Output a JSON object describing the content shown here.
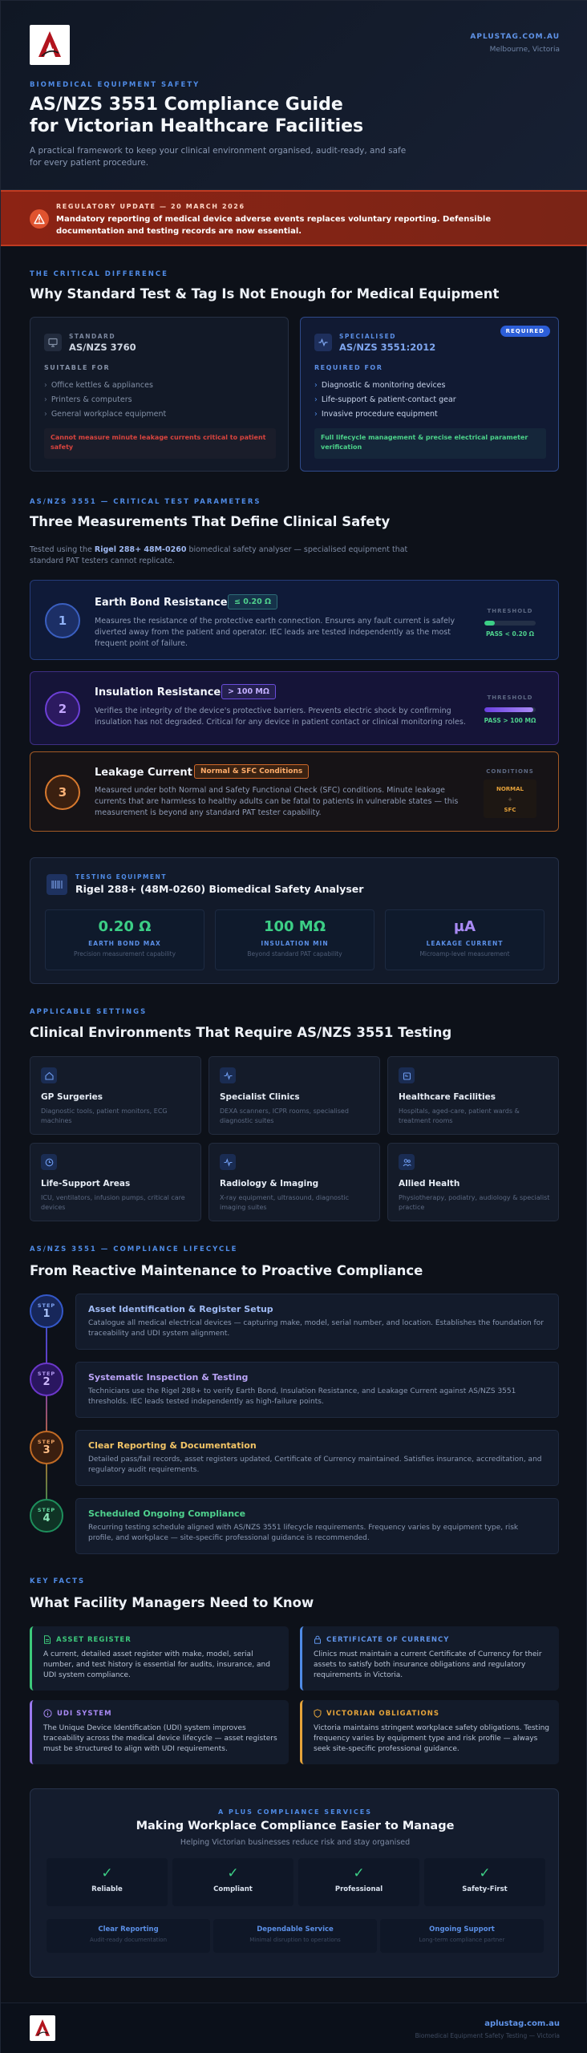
{
  "header": {
    "url": "APLUSTAG.COM.AU",
    "location": "Melbourne, Victoria",
    "eyebrow": "BIOMEDICAL EQUIPMENT SAFETY",
    "title_line1": "AS/NZS 3551 Compliance Guide",
    "title_line2": "for Victorian Healthcare Facilities",
    "subtitle": "A practical framework to keep your clinical environment organised, audit-ready, and safe for every patient procedure."
  },
  "alert": {
    "eyebrow": "REGULATORY UPDATE — 20 MARCH 2026",
    "text": "Mandatory reporting of medical device adverse events replaces voluntary reporting. Defensible documentation and testing records are now essential."
  },
  "difference": {
    "eyebrow": "THE CRITICAL DIFFERENCE",
    "title": "Why Standard Test & Tag Is Not Enough for Medical Equipment",
    "standard": {
      "small": "STANDARD",
      "name": "AS/NZS 3760",
      "suitable": "SUITABLE FOR",
      "items": [
        "Office kettles & appliances",
        "Printers & computers",
        "General workplace equipment"
      ],
      "note": "Cannot measure minute leakage currents critical to patient safety"
    },
    "specialised": {
      "badge": "REQUIRED",
      "small": "SPECIALISED",
      "name": "AS/NZS 3551:2012",
      "required": "REQUIRED FOR",
      "items": [
        "Diagnostic & monitoring devices",
        "Life-support & patient-contact gear",
        "Invasive procedure equipment"
      ],
      "note": "Full lifecycle management & precise electrical parameter verification"
    }
  },
  "measurements": {
    "eyebrow": "AS/NZS 3551 — CRITICAL TEST PARAMETERS",
    "title": "Three Measurements That Define Clinical Safety",
    "intro_pre": "Tested using the ",
    "intro_bold": "Rigel 288+ 48M-0260",
    "intro_post": " biomedical safety analyser — specialised equipment that standard PAT testers cannot replicate.",
    "items": [
      {
        "num": "1",
        "title": "Earth Bond Resistance",
        "tag": "≤ 0.20 Ω",
        "desc": "Measures the resistance of the protective earth connection. Ensures any fault current is safely diverted away from the patient and operator. IEC leads are tested independently as the most frequent point of failure.",
        "side_label": "THRESHOLD",
        "side_value": "PASS < 0.20 Ω",
        "bar_fraction": 0.2
      },
      {
        "num": "2",
        "title": "Insulation Resistance",
        "tag": "> 100 MΩ",
        "desc": "Verifies the integrity of the device's protective barriers. Prevents electric shock by confirming insulation has not degraded. Critical for any device in patient contact or clinical monitoring roles.",
        "side_label": "THRESHOLD",
        "side_value": "PASS > 100 MΩ",
        "bar_fraction": 0.95
      },
      {
        "num": "3",
        "title": "Leakage Current",
        "tag": "Normal & SFC Conditions",
        "desc": "Measured under both Normal and Safety Functional Check (SFC) conditions. Minute leakage currents that are harmless to healthy adults can be fatal to patients in vulnerable states — this measurement is beyond any standard PAT tester capability.",
        "side_label": "CONDITIONS",
        "cond_a": "NORMAL",
        "cond_plus": "+",
        "cond_b": "SFC"
      }
    ]
  },
  "analyser": {
    "small": "TESTING EQUIPMENT",
    "title": "Rigel 288+ (48M-0260) Biomedical Safety Analyser",
    "stats": [
      {
        "value": "0.20 Ω",
        "label": "EARTH BOND MAX",
        "sub": "Precision measurement capability",
        "color": "#3ccf86"
      },
      {
        "value": "100 MΩ",
        "label": "INSULATION MIN",
        "sub": "Beyond standard PAT capability",
        "color": "#3ccf86"
      },
      {
        "value": "µA",
        "label": "LEAKAGE CURRENT",
        "sub": "Microamp-level measurement",
        "color": "#a98af5"
      }
    ]
  },
  "settings": {
    "eyebrow": "APPLICABLE SETTINGS",
    "title": "Clinical Environments That Require AS/NZS 3551 Testing",
    "items": [
      {
        "icon": "house-icon",
        "title": "GP Surgeries",
        "desc": "Diagnostic tools, patient monitors, ECG machines"
      },
      {
        "icon": "pulse-icon",
        "title": "Specialist Clinics",
        "desc": "DEXA scanners, ICPR rooms, specialised diagnostic suites"
      },
      {
        "icon": "clipboard-icon",
        "title": "Healthcare Facilities",
        "desc": "Hospitals, aged-care, patient wards & treatment rooms"
      },
      {
        "icon": "clock-icon",
        "title": "Life-Support Areas",
        "desc": "ICU, ventilators, infusion pumps, critical care devices"
      },
      {
        "icon": "pulse-icon",
        "title": "Radiology & Imaging",
        "desc": "X-ray equipment, ultrasound, diagnostic imaging suites"
      },
      {
        "icon": "people-icon",
        "title": "Allied Health",
        "desc": "Physiotherapy, podiatry, audiology & specialist practice"
      }
    ]
  },
  "lifecycle": {
    "eyebrow": "AS/NZS 3551 — COMPLIANCE LIFECYCLE",
    "title": "From Reactive Maintenance to Proactive Compliance",
    "step_label": "STEP",
    "steps": [
      {
        "num": "1",
        "title": "Asset Identification & Register Setup",
        "desc": "Catalogue all medical electrical devices — capturing make, model, serial number, and location. Establishes the foundation for traceability and UDI system alignment."
      },
      {
        "num": "2",
        "title": "Systematic Inspection & Testing",
        "desc": "Technicians use the Rigel 288+ to verify Earth Bond, Insulation Resistance, and Leakage Current against AS/NZS 3551 thresholds. IEC leads tested independently as high-failure points."
      },
      {
        "num": "3",
        "title": "Clear Reporting & Documentation",
        "desc": "Detailed pass/fail records, asset registers updated, Certificate of Currency maintained. Satisfies insurance, accreditation, and regulatory audit requirements."
      },
      {
        "num": "4",
        "title": "Scheduled Ongoing Compliance",
        "desc": "Recurring testing schedule aligned with AS/NZS 3551 lifecycle requirements. Frequency varies by equipment type, risk profile, and workplace — site-specific professional guidance is recommended."
      }
    ]
  },
  "facts": {
    "eyebrow": "KEY FACTS",
    "title": "What Facility Managers Need to Know",
    "items": [
      {
        "title": "ASSET REGISTER",
        "desc": "A current, detailed asset register with make, model, serial number, and test history is essential for audits, insurance, and UDI system compliance.",
        "color": "#3cc97b"
      },
      {
        "title": "CERTIFICATE OF CURRENCY",
        "desc": "Clinics must maintain a current Certificate of Currency for their assets to satisfy both insurance obligations and regulatory requirements in Victoria.",
        "color": "#4f8be6"
      },
      {
        "title": "UDI SYSTEM",
        "desc": "The Unique Device Identification (UDI) system improves traceability across the medical device lifecycle — asset registers must be structured to align with UDI requirements.",
        "color": "#9b79f0"
      },
      {
        "title": "VICTORIAN OBLIGATIONS",
        "desc": "Victoria maintains stringent workplace safety obligations. Testing frequency varies by equipment type and risk profile — always seek site-specific professional guidance.",
        "color": "#e6a43a"
      }
    ]
  },
  "services": {
    "eyebrow": "A PLUS COMPLIANCE SERVICES",
    "title": "Making Workplace Compliance Easier to Manage",
    "subtitle": "Helping Victorian businesses reduce risk and stay organised",
    "check": "✓",
    "pills": [
      "Reliable",
      "Compliant",
      "Professional",
      "Safety-First"
    ],
    "items": [
      {
        "title": "Clear Reporting",
        "desc": "Audit-ready documentation"
      },
      {
        "title": "Dependable Service",
        "desc": "Minimal disruption to operations"
      },
      {
        "title": "Ongoing Support",
        "desc": "Long-term compliance partner"
      }
    ]
  },
  "footer": {
    "url": "aplustag.com.au",
    "tagline": "Biomedical Equipment Safety Testing — Victoria"
  }
}
